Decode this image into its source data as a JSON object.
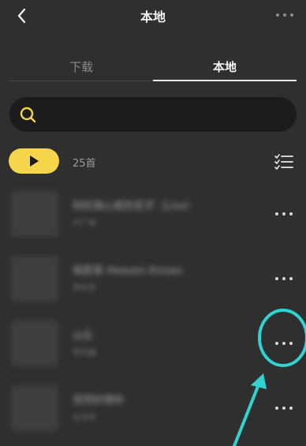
{
  "header": {
    "title": "本地"
  },
  "tabs": [
    {
      "label": "下载"
    },
    {
      "label": "本地"
    }
  ],
  "toolbar": {
    "song_count": "25首"
  },
  "songs": [
    {
      "title": "刻在我心底的名字（Live）",
      "subtitle": "卢广仲"
    },
    {
      "title": "我愿意 Heaven Knows",
      "subtitle": "李玖哲"
    },
    {
      "title": "山丘",
      "subtitle": "李宗盛"
    },
    {
      "title": "突然好想你",
      "subtitle": "五月天"
    }
  ],
  "colors": {
    "background": "#2f2f2f",
    "accent": "#f7d54a",
    "annotation": "#2fd3d0"
  },
  "icons": {
    "back": "chevron-left-icon",
    "more": "more-dots-icon",
    "search": "search-icon",
    "play": "play-icon",
    "manage": "list-check-icon"
  }
}
